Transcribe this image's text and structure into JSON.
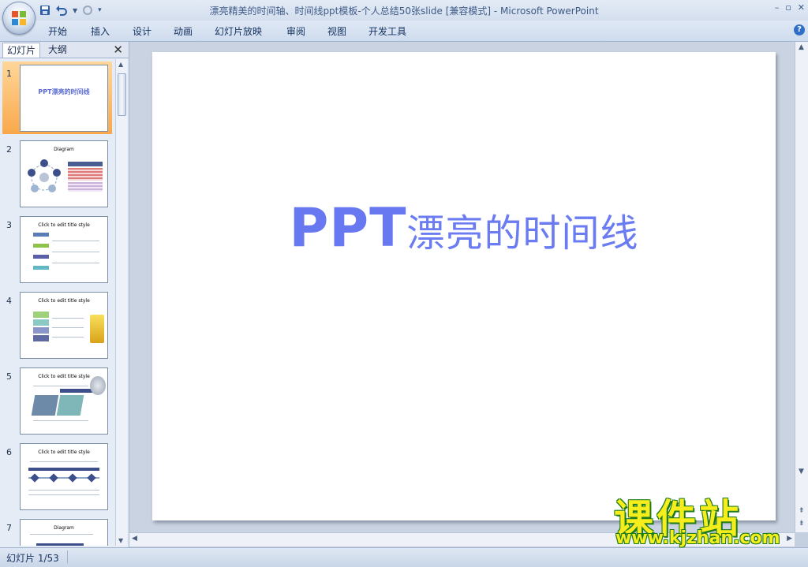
{
  "window": {
    "title": "漂亮精美的时间轴、时间线ppt模板-个人总结50张slide [兼容模式] - Microsoft PowerPoint",
    "controls": [
      "–",
      "▫",
      "✕"
    ]
  },
  "quick_access": {
    "icons": [
      "save-icon",
      "undo-icon",
      "redo-icon",
      "customize-icon"
    ]
  },
  "ribbon": {
    "tabs": [
      "开始",
      "插入",
      "设计",
      "动画",
      "幻灯片放映",
      "审阅",
      "视图",
      "开发工具"
    ],
    "help_label": "?"
  },
  "left_panel": {
    "tabs": [
      "幻灯片",
      "大纲"
    ],
    "close_label": "✕",
    "thumbnails": [
      {
        "num": "1",
        "title": "PPT漂亮的时间线",
        "selected": true
      },
      {
        "num": "2",
        "title": "Diagram"
      },
      {
        "num": "3",
        "title": "Click to edit title style"
      },
      {
        "num": "4",
        "title": "Click to edit title style"
      },
      {
        "num": "5",
        "title": "Click to edit title style"
      },
      {
        "num": "6",
        "title": "Click to edit title style"
      },
      {
        "num": "7",
        "title": "Diagram"
      }
    ]
  },
  "slide": {
    "title_latin": "PPT",
    "title_cjk": "漂亮的时间线"
  },
  "status_bar": {
    "slide_count": "幻灯片 1/53"
  },
  "watermark": {
    "main": "课件站",
    "url": "www.kjzhan.com"
  },
  "colors": {
    "title_blue": "#6b7cf2",
    "selection_orange": "#f9a84b",
    "watermark_yellow": "#f6ee1c",
    "watermark_green": "#1f7a1a"
  }
}
